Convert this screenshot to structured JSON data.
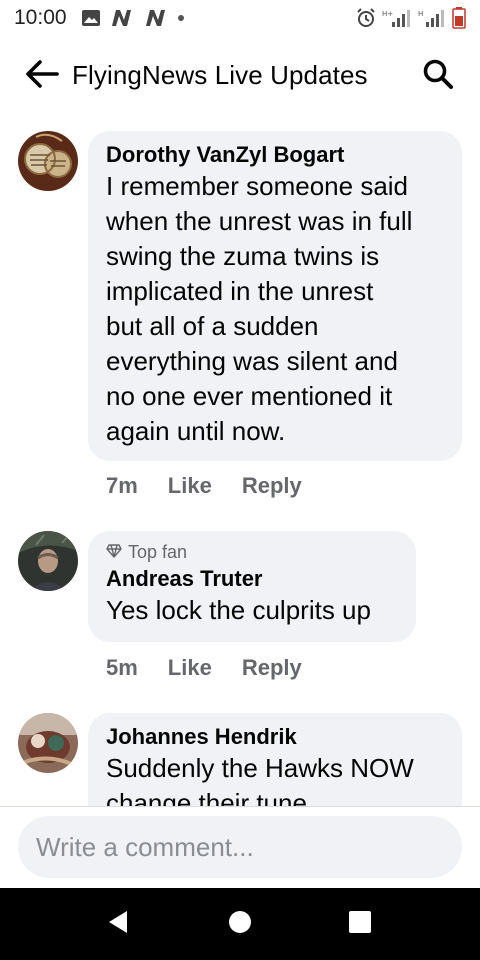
{
  "status_bar": {
    "time": "10:00"
  },
  "header": {
    "title": "FlyingNews Live Updates"
  },
  "comments": [
    {
      "author": "Dorothy VanZyl Bogart",
      "text_lines": [
        "I remember someone said",
        "when the unrest was in full",
        "swing the zuma twins is",
        "implicated in the unrest",
        "but all of a sudden",
        "everything was silent and",
        "no one ever mentioned it",
        "again until now."
      ],
      "time": "7m",
      "like": "Like",
      "reply": "Reply"
    },
    {
      "badge": "Top fan",
      "author": "Andreas Truter",
      "text_lines": [
        "Yes lock the culprits up"
      ],
      "time": "5m",
      "like": "Like",
      "reply": "Reply"
    },
    {
      "author": "Johannes Hendrik",
      "text_lines": [
        "Suddenly the Hawks NOW",
        "change their tune"
      ]
    }
  ],
  "composer": {
    "placeholder": "Write a comment..."
  },
  "colors": {
    "bubble": "#f0f2f5",
    "meta": "#65676b",
    "nav": "#000000"
  }
}
